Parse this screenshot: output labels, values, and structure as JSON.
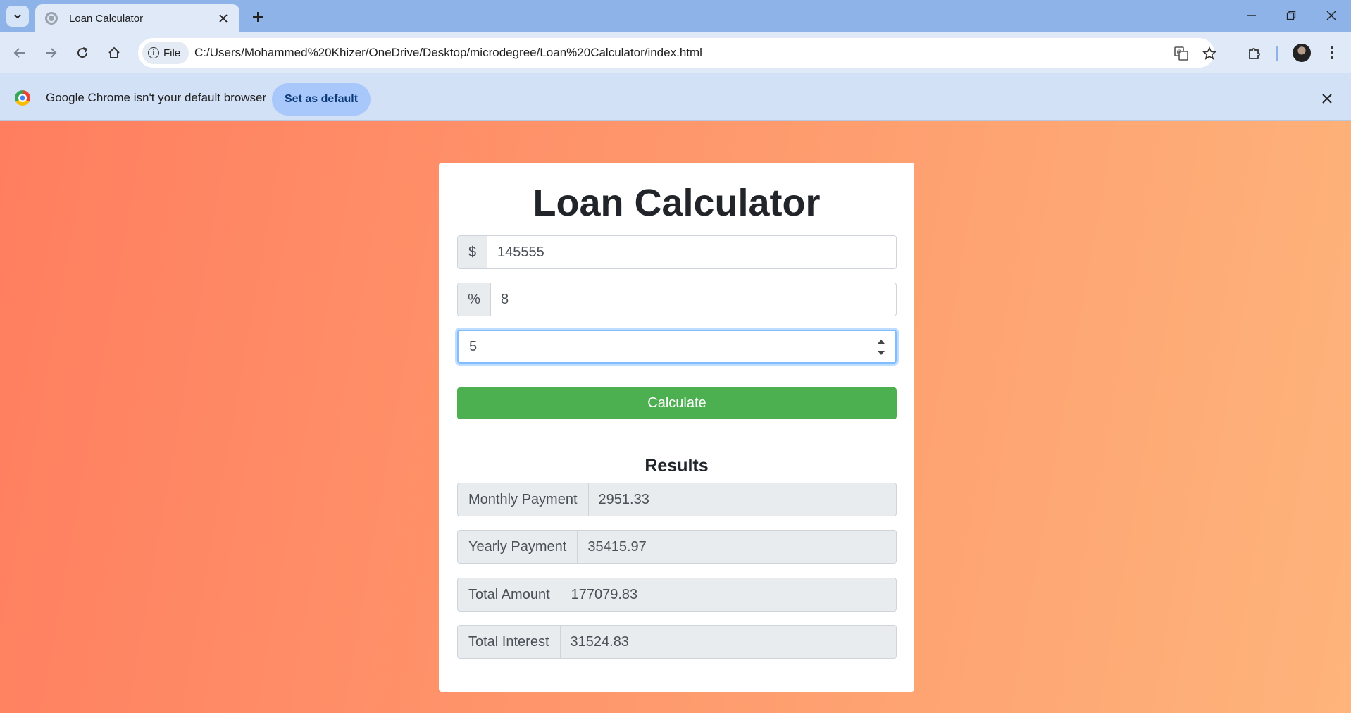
{
  "browser": {
    "tab_title": "Loan Calculator",
    "site_chip_label": "File",
    "url": "C:/Users/Mohammed%20Khizer/OneDrive/Desktop/microdegree/Loan%20Calculator/index.html",
    "infobar_message": "Google Chrome isn't your default browser",
    "set_default_label": "Set as default"
  },
  "app": {
    "title": "Loan Calculator",
    "amount": {
      "prefix": "$",
      "value": "145555"
    },
    "interest": {
      "prefix": "%",
      "value": "8"
    },
    "years": {
      "value": "5"
    },
    "calculate_label": "Calculate",
    "results_title": "Results",
    "results": [
      {
        "label": "Monthly Payment",
        "value": "2951.33"
      },
      {
        "label": "Yearly Payment",
        "value": "35415.97"
      },
      {
        "label": "Total Amount",
        "value": "177079.83"
      },
      {
        "label": "Total Interest",
        "value": "31524.83"
      }
    ]
  },
  "colors": {
    "tabstrip": "#8eb3e8",
    "toolbar": "#dfe9f8",
    "infobar": "#d3e1f7",
    "gradient_start": "#ff7e5f",
    "gradient_end": "#feb47b",
    "calculate_button": "#4caf50"
  },
  "icons": [
    "tab-search-icon",
    "globe-icon",
    "close-icon",
    "plus-icon",
    "minimize-icon",
    "restore-icon",
    "back-arrow-icon",
    "forward-arrow-icon",
    "reload-icon",
    "home-icon",
    "info-icon",
    "translate-icon",
    "star-icon",
    "extensions-icon",
    "chrome-logo-icon"
  ]
}
